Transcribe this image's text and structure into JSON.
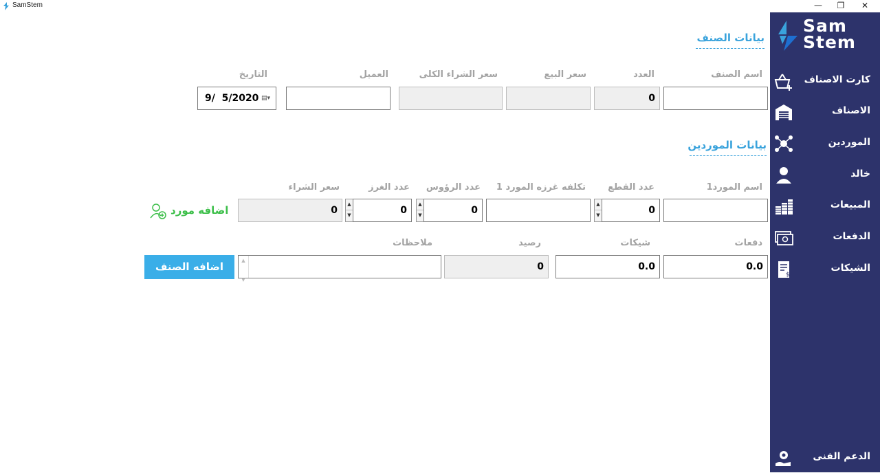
{
  "window": {
    "title": "SamStem",
    "minimize": "—",
    "restore": "❐",
    "close": "✕"
  },
  "brand": {
    "line1": "Sam",
    "line2": "Stem"
  },
  "sidebar": {
    "items": [
      {
        "label": "كارت الاصناف",
        "icon": "basket-add-icon"
      },
      {
        "label": "الاصناف",
        "icon": "warehouse-icon"
      },
      {
        "label": "الموردين",
        "icon": "network-icon"
      },
      {
        "label": "خالد",
        "icon": "user-icon"
      },
      {
        "label": "المبيعات",
        "icon": "coins-icon"
      },
      {
        "label": "الدفعات",
        "icon": "money-icon"
      },
      {
        "label": "الشيكات",
        "icon": "check-document-icon"
      }
    ],
    "support": {
      "label": "الدعم الفنى",
      "icon": "support-gear-hand-icon"
    }
  },
  "item_section": {
    "title": "بيانات الصنف",
    "labels": {
      "name": "اسم الصنف",
      "count": "العدد",
      "sale_price": "سعر البيع",
      "total_purchase": "سعر الشراء الكلى",
      "customer": "العميل",
      "date": "التاريخ"
    },
    "values": {
      "name": "",
      "count": "0",
      "sale_price": "",
      "total_purchase": "",
      "customer": "",
      "date": "9/  5/2020"
    }
  },
  "supplier_section": {
    "title": "بيانات الموردين",
    "labels": {
      "supplier_name": "اسم المورد1",
      "pieces": "عدد القطع",
      "stitch_cost": "تكلفه غرزه المورد 1",
      "heads": "عدد الرؤوس",
      "stitches": "عدد الغرز",
      "purchase_price": "سعر الشراء"
    },
    "values": {
      "supplier_name": "",
      "pieces": "0",
      "stitch_cost": "",
      "heads": "0",
      "stitches": "0",
      "purchase_price": "0"
    },
    "add_supplier_label": "اضافه مورد",
    "payments_labels": {
      "payments": "دفعات",
      "checks": "شيكات",
      "balance": "رصيد",
      "notes": "ملاحظات"
    },
    "payments_values": {
      "payments": "0.0",
      "checks": "0.0",
      "balance": "0",
      "notes": ""
    },
    "add_item_label": "اضافه الصنف"
  },
  "colors": {
    "sidebar_bg": "#2d336b",
    "accent": "#3aa3dc",
    "button": "#3aaee8",
    "add_supplier": "#3dbf4a"
  }
}
